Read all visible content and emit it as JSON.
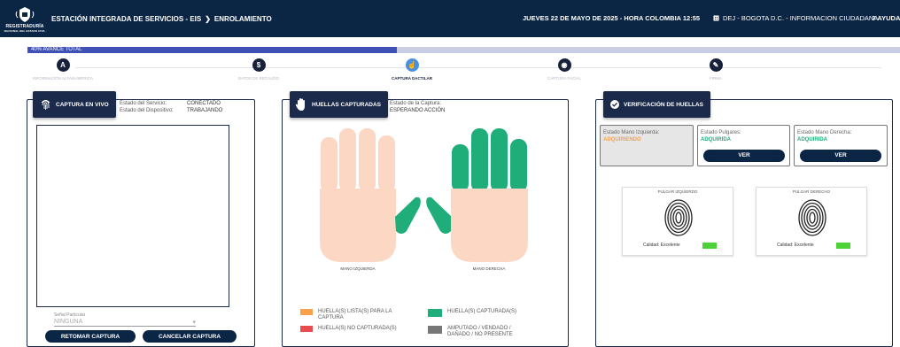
{
  "header": {
    "logo_text": "REGISTRADURÍA",
    "logo_subtext": "NACIONAL DEL ESTADO CIVIL",
    "app_title": "ESTACIÓN INTEGRADA DE SERVICIOS - EIS",
    "breadcrumb_separator": "❯",
    "section": "ENROLAMIENTO",
    "datetime": "JUEVES 22 DE MAYO DE 2025 - HORA COLOMBIA 12:55",
    "office": "DEJ - BOGOTA D.C. - INFORMACION CIUDADANA",
    "help_icon": "?",
    "help_label": "AYUDA"
  },
  "progress": {
    "label": "40% AVANCE TOTAL",
    "percent": 40
  },
  "steps": [
    {
      "icon": "A",
      "label": "INFORMACIÓN ALFANUMÉRICA",
      "active": false
    },
    {
      "icon": "$",
      "label": "DATOS DE RECAUDO",
      "active": false
    },
    {
      "icon": "☝",
      "label": "CAPTURA DACTILAR",
      "active": true
    },
    {
      "icon": "◉",
      "label": "CAPTURA FACIAL",
      "active": false
    },
    {
      "icon": "✎",
      "label": "FIRMA",
      "active": false
    }
  ],
  "live": {
    "title": "CAPTURA EN VIVO",
    "service_label": "Estado del Servicio:",
    "service_value": "CONECTADO",
    "device_label": "Estado del Dispositivo:",
    "device_value": "TRABAJANDO",
    "senal_label": "Señal Particular",
    "senal_value": "NINGUNA",
    "btn_retake": "RETOMAR CAPTURA",
    "btn_cancel": "CANCELAR CAPTURA"
  },
  "huellas": {
    "title": "HUELLAS CAPTURADAS",
    "capture_label": "Estado de la Captura:",
    "capture_value": "ESPERANDO ACCIÓN",
    "left_hand": "MANO IZQUIERDA",
    "right_hand": "MANO DERECHA",
    "legend": [
      {
        "color": "#f7a24a",
        "text": "HUELLA(S) LISTA(S) PARA LA CAPTURA"
      },
      {
        "color": "#e84c4c",
        "text": "HUELLA(S) NO CAPTURADA(S)"
      },
      {
        "color": "#1fae7a",
        "text": "HUELLA(S) CAPTURADA(S)"
      },
      {
        "color": "#777777",
        "text": "AMPUTADO / VENDADO / DAÑADO / NO PRESENTE"
      }
    ]
  },
  "verif": {
    "title": "VERIFICACIÓN DE HUELLAS",
    "left": {
      "label": "Estado Mano Izquierda:",
      "value": "ADQUIRIENDO"
    },
    "thumbs": {
      "label": "Estado Pulgares:",
      "value": "ADQUIRIDA",
      "button": "VER"
    },
    "right": {
      "label": "Estado Mano Derecha:",
      "value": "ADQUIRIDA",
      "button": "VER"
    },
    "card_left": {
      "title": "PULGAR IZQUIERDO",
      "quality": "Calidad: Excelente"
    },
    "card_right": {
      "title": "PULGAR DERECHO",
      "quality": "Calidad: Excelente"
    }
  },
  "colors": {
    "navy": "#0b2545",
    "skin": "#fbd7c4",
    "green": "#1fae7a",
    "orange": "#f7a24a"
  }
}
